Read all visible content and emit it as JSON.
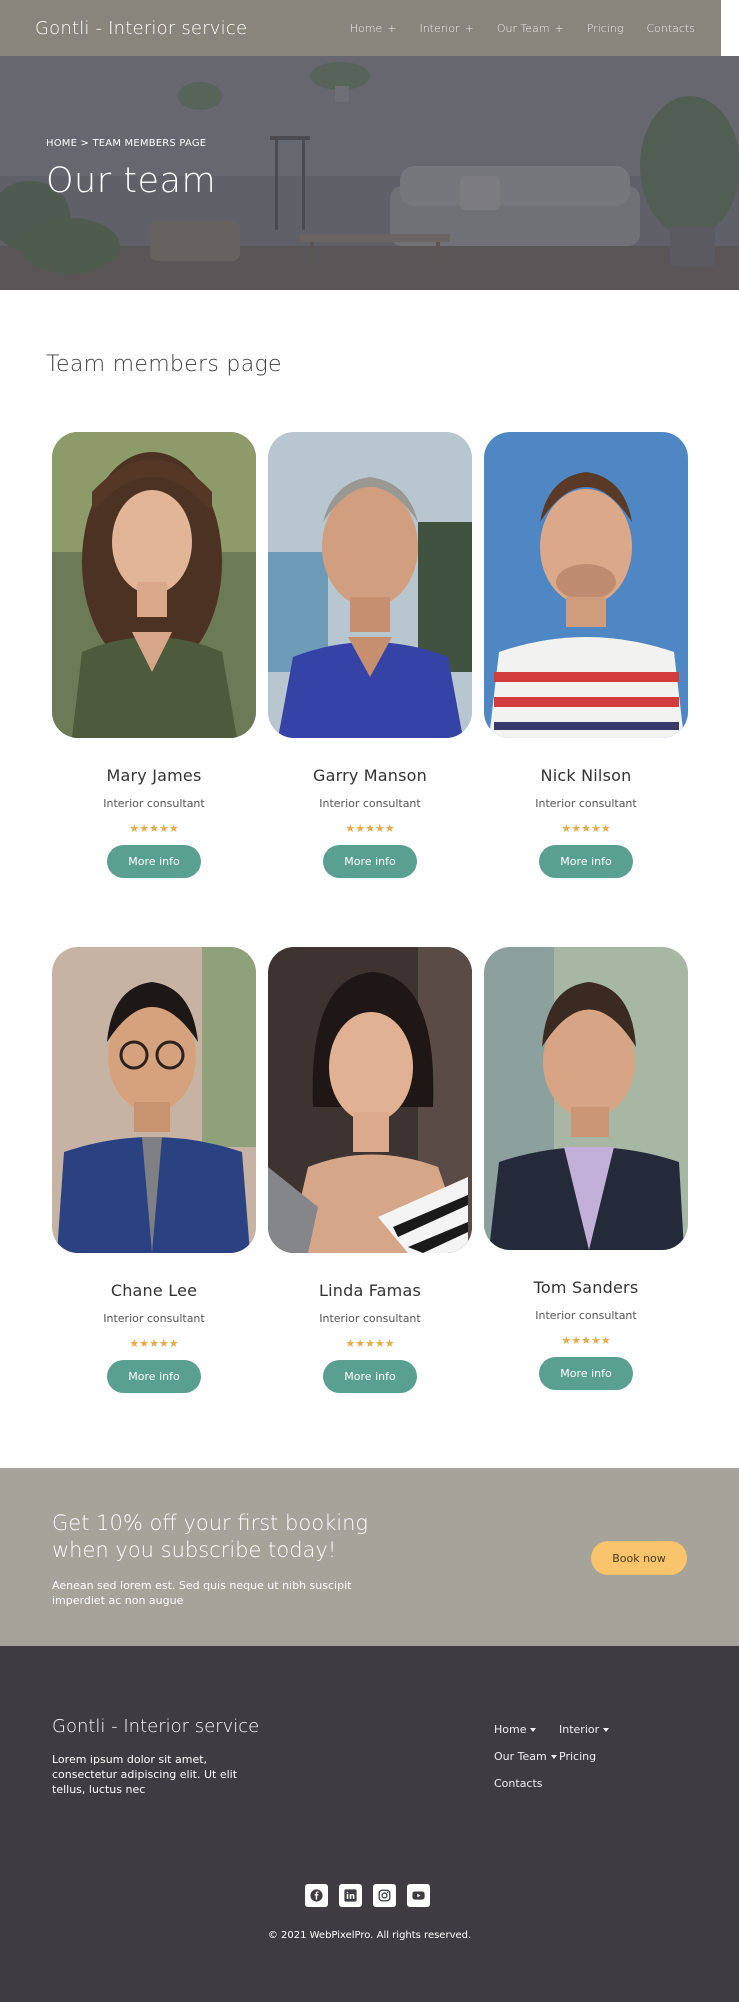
{
  "header": {
    "logo": "Gontli - Interior service",
    "nav": [
      {
        "label": "Home",
        "has_submenu": true
      },
      {
        "label": "Interior",
        "has_submenu": true
      },
      {
        "label": "Our Team",
        "has_submenu": true
      },
      {
        "label": "Pricing",
        "has_submenu": false
      },
      {
        "label": "Contacts",
        "has_submenu": false
      }
    ],
    "submenu_symbol": "+"
  },
  "hero": {
    "breadcrumb": "HOME > TEAM MEMBERS PAGE",
    "title": "Our team"
  },
  "team": {
    "title": "Team members page",
    "members": [
      {
        "name": "Mary James",
        "role": "Interior consultant",
        "rating": 5,
        "button": "More info"
      },
      {
        "name": "Garry Manson",
        "role": "Interior consultant",
        "rating": 5,
        "button": "More info"
      },
      {
        "name": "Nick Nilson",
        "role": "Interior consultant",
        "rating": 5,
        "button": "More info"
      },
      {
        "name": "Chane Lee",
        "role": "Interior consultant",
        "rating": 5,
        "button": "More info"
      },
      {
        "name": "Linda Famas",
        "role": "Interior consultant",
        "rating": 5,
        "button": "More info"
      },
      {
        "name": "Tom Sanders",
        "role": "Interior consultant",
        "rating": 5,
        "button": "More info"
      }
    ]
  },
  "promo": {
    "headline": "Get 10% off your first booking when you subscribe today!",
    "text": "Aenean sed lorem est. Sed quis neque ut nibh suscipit imperdiet ac non augue",
    "button": "Book now"
  },
  "footer": {
    "logo": "Gontli - Interior service",
    "about": "Lorem ipsum dolor sit amet, consectetur adipiscing elit. Ut elit tellus, luctus nec",
    "nav": [
      {
        "label": "Home",
        "has_submenu": true
      },
      {
        "label": "Interior",
        "has_submenu": true
      },
      {
        "label": "Our Team",
        "has_submenu": true
      },
      {
        "label": "Pricing",
        "has_submenu": false
      },
      {
        "label": "Contacts",
        "has_submenu": false
      }
    ],
    "social": [
      "facebook-icon",
      "linkedin-icon",
      "instagram-icon",
      "youtube-icon"
    ],
    "copyright": "© 2021 WebPixelPro. All rights reserved."
  },
  "colors": {
    "header_bg": "#8a857c",
    "accent_button": "#5aa091",
    "star": "#e9a949",
    "promo_bg": "#a6a39b",
    "book_button": "#f9c46b",
    "footer_bg": "#3e3c40"
  }
}
